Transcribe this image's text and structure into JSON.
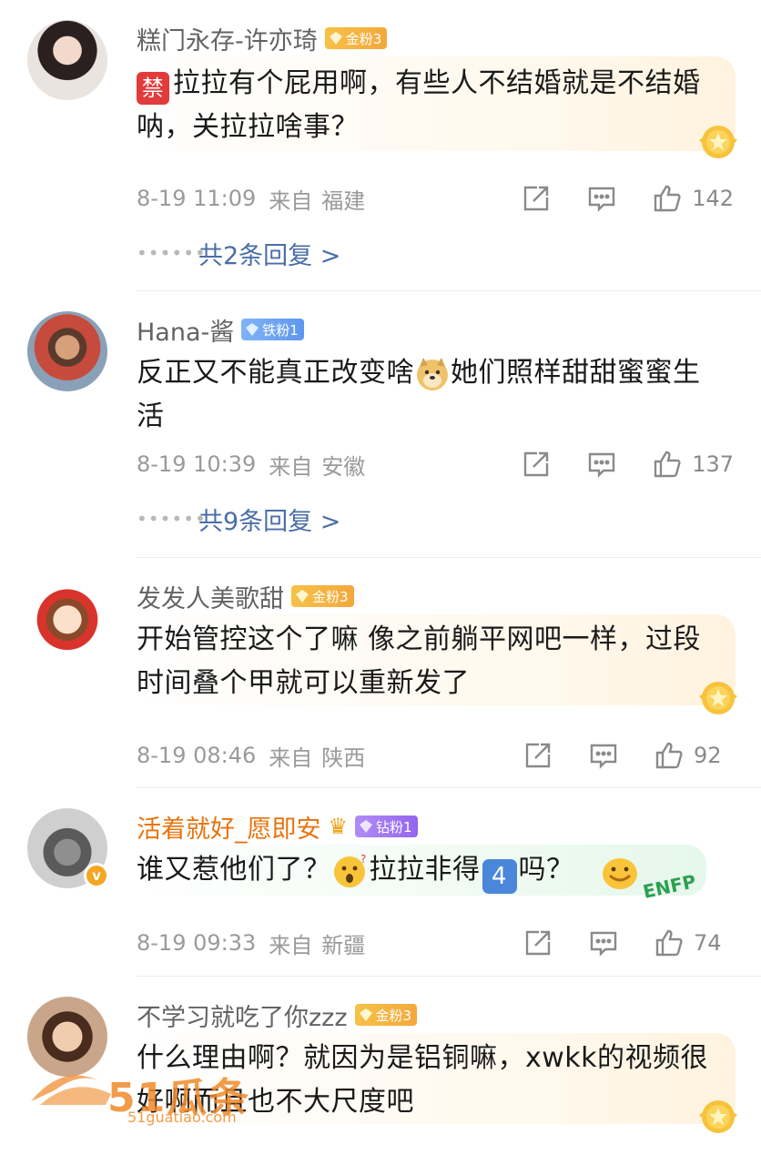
{
  "comments": [
    {
      "username": "糕门永存-许亦琦",
      "badge": "金粉3",
      "ban_glyph": "禁",
      "text_line1": "拉拉有个屁用啊，有些人不结婚就是不结婚",
      "text_line2": "呐，关拉拉啥事？",
      "date": "8-19 11:09",
      "from_label": "来自",
      "location": "福建",
      "likes": "142",
      "replies": "共2条回复 >"
    },
    {
      "username": "Hana-酱",
      "badge": "铁粉1",
      "text_part1": "反正又不能真正改变啥",
      "text_part2": "她们照样甜甜蜜蜜生",
      "text_line2": "活",
      "date": "8-19 10:39",
      "from_label": "来自",
      "location": "安徽",
      "likes": "137",
      "replies": "共9条回复 >"
    },
    {
      "username": "发发人美歌甜",
      "badge": "金粉3",
      "text_line1": "开始管控这个了嘛 像之前躺平网吧一样，过段",
      "text_line2": "时间叠个甲就可以重新发了",
      "date": "8-19 08:46",
      "from_label": "来自",
      "location": "陕西",
      "likes": "92"
    },
    {
      "username": "活着就好_愿即安",
      "badge": "钻粉1",
      "verified_glyph": "v",
      "text_part1": "谁又惹他们了？",
      "text_part2": "拉拉非得",
      "num_glyph": "4",
      "text_part3": "吗？",
      "sticker_label": "ENFP",
      "date": "8-19 09:33",
      "from_label": "来自",
      "location": "新疆",
      "likes": "74"
    },
    {
      "username": "不学习就吃了你zzz",
      "badge": "金粉3",
      "text_line1": "什么理由啊？就因为是铝铜嘛，xwkk的视频很",
      "text_line2": "好啊而且也不大尺度吧"
    }
  ],
  "watermark": {
    "text": "51瓜条",
    "url": "51guatiao.com"
  },
  "icons": [
    "share-icon",
    "comment-icon",
    "like-icon",
    "gold-medal-icon"
  ],
  "colors": {
    "link": "#4a6ea8",
    "vip_name": "#e8730c",
    "gold_badge": "#f3a83c",
    "iron_badge": "#5f97ef",
    "diamond_badge": "#9466ee"
  }
}
